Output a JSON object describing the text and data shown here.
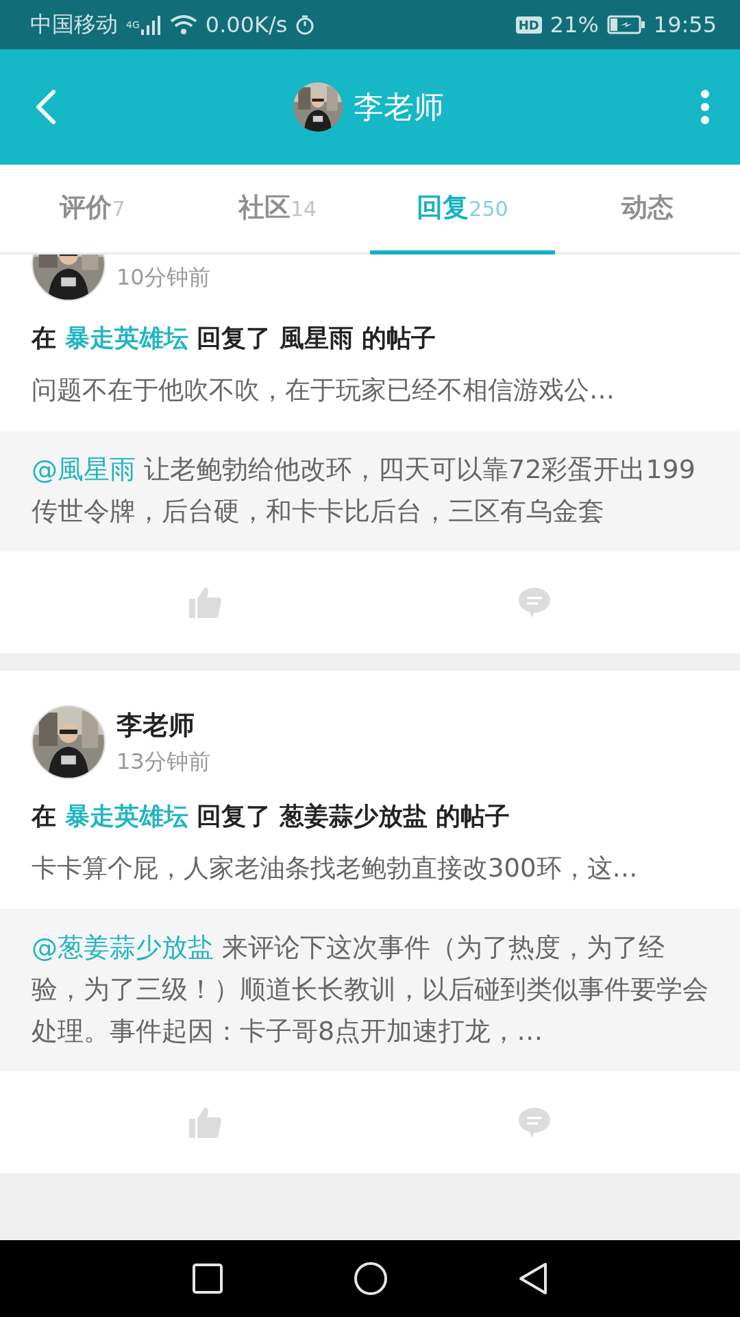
{
  "status_bar": {
    "carrier": "中国移动",
    "network": "4G",
    "speed": "0.00K/s",
    "hd": "HD",
    "battery": "21%",
    "time": "19:55"
  },
  "header": {
    "title": "李老师"
  },
  "tabs": [
    {
      "label": "评价",
      "count": "7",
      "selected": false
    },
    {
      "label": "社区",
      "count": "14",
      "selected": false
    },
    {
      "label": "回复",
      "count": "250",
      "selected": true
    },
    {
      "label": "动态",
      "selected": false
    }
  ],
  "posts": [
    {
      "time": "10分钟前",
      "title": {
        "prefix": "在",
        "forum": "暴走英雄坛",
        "suffix": "回复了 風星雨 的帖子"
      },
      "excerpt": "问题不在于他吹不吹，在于玩家已经不相信游戏公…",
      "quote": {
        "mention": "@風星雨",
        "text": "让老鲍勃给他改环，四天可以靠72彩蛋开出199传世令牌，后台硬，和卡卡比后台，三区有乌金套"
      }
    },
    {
      "name": "李老师",
      "time": "13分钟前",
      "title": {
        "prefix": "在",
        "forum": "暴走英雄坛",
        "suffix": "回复了 葱姜蒜少放盐 的帖子"
      },
      "excerpt": "卡卡算个屁，人家老油条找老鲍勃直接改300环，这…",
      "quote": {
        "mention": "@葱姜蒜少放盐",
        "text": "来评论下这次事件（为了热度，为了经验，为了三级！）顺道长长教训，以后碰到类似事件要学会处理。事件起因：卡子哥8点开加速打龙，…"
      }
    }
  ]
}
